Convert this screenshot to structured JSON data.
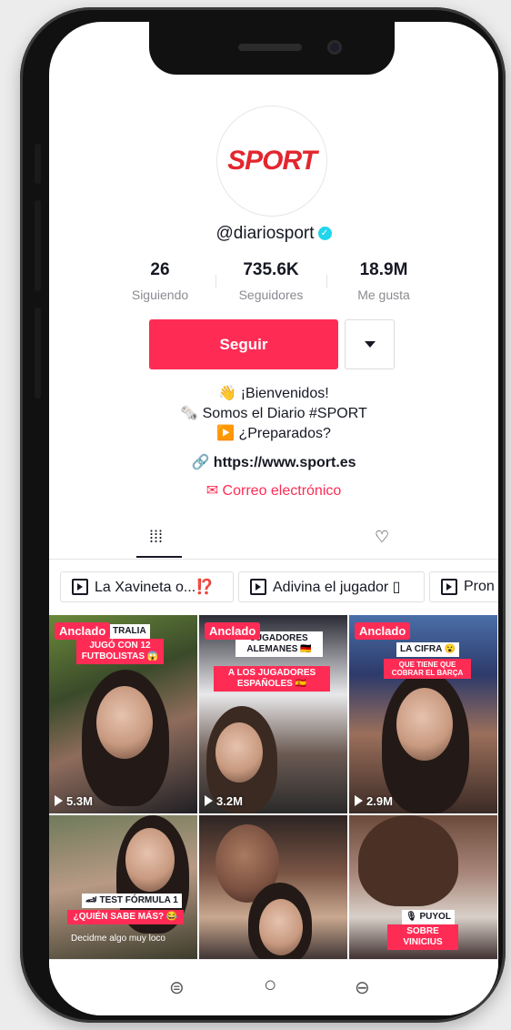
{
  "profile": {
    "avatar_text": "SPORT",
    "username": "@diariosport",
    "verified_mark": "✓"
  },
  "stats": [
    {
      "value": "26",
      "label": "Siguiendo"
    },
    {
      "value": "735.6K",
      "label": "Seguidores"
    },
    {
      "value": "18.9M",
      "label": "Me gusta"
    }
  ],
  "actions": {
    "follow_label": "Seguir"
  },
  "bio": {
    "line1": "👋 ¡Bienvenidos!",
    "line2": "🗞️ Somos el Diario #SPORT",
    "line3": "▶️ ¿Preparados?",
    "link": "🔗 https://www.sport.es",
    "email": "✉ Correo electrónico"
  },
  "tabs": {
    "videos_icon": "⁞⁞⁞",
    "liked_icon": "♡"
  },
  "playlists": [
    {
      "label": "La Xavineta o...⁉️"
    },
    {
      "label": "Adivina el jugador ▯"
    },
    {
      "label": "Pron"
    }
  ],
  "videos": [
    {
      "pinned": "Anclado",
      "views": "5.3M",
      "caption1": "TRALIA",
      "caption2": "JUGÓ CON 12 FUTBOLISTAS 😱"
    },
    {
      "pinned": "Anclado",
      "views": "3.2M",
      "caption1": "JUGADORES ALEMANES 🇩🇪",
      "caption2": "A LOS JUGADORES ESPAÑOLES 🇪🇸"
    },
    {
      "pinned": "Anclado",
      "views": "2.9M",
      "caption1": "LA CIFRA 😮",
      "caption2": "QUE TIENE QUE COBRAR EL BARÇA"
    },
    {
      "caption1": "🏎 TEST FÓRMULA 1",
      "caption2": "¿QUIÉN SABE MÁS? 😂",
      "caption3": "Decidme algo muy loco"
    },
    {},
    {
      "caption1": "🎙 PUYOL",
      "caption2": "SOBRE VINICIUS"
    }
  ],
  "navbar": {
    "left_icon": "⊜",
    "home_icon": "○",
    "back_icon": "⊖"
  },
  "colors": {
    "accent": "#fe2c55",
    "verified": "#20d5ec",
    "logo": "#e3262e"
  }
}
